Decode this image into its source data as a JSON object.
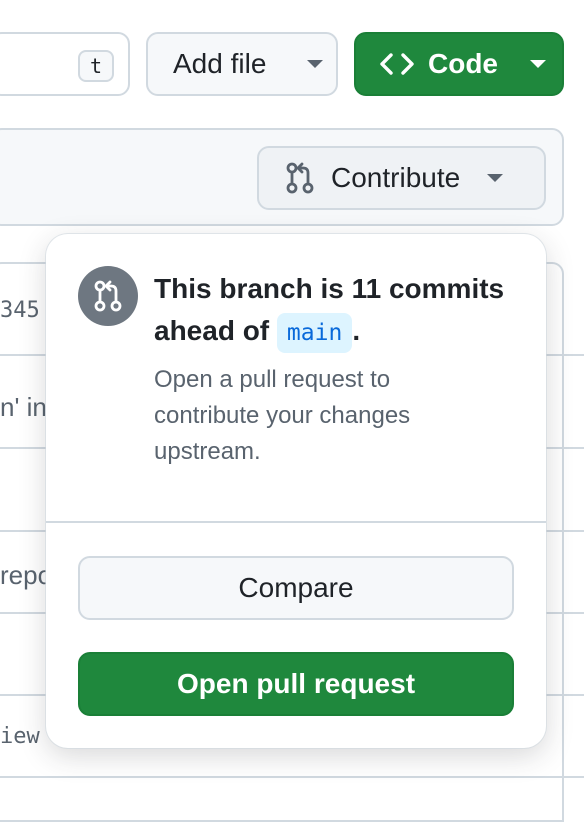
{
  "toolbar": {
    "search_shortcut": "t",
    "add_file_label": "Add file",
    "code_label": "Code"
  },
  "branch_bar": {
    "contribute_label": "Contribute"
  },
  "file_table": {
    "partial_rows": [
      "345",
      "n' in",
      "repo",
      "iew"
    ]
  },
  "popover": {
    "title_prefix": "This branch is 11 commits ahead of",
    "branch": "main",
    "title_suffix": ".",
    "description": "Open a pull request to contribute your changes upstream.",
    "compare_label": "Compare",
    "open_pr_label": "Open pull request"
  },
  "colors": {
    "primary_green": "#1f883d",
    "branch_pill_bg": "#ddf4ff",
    "branch_pill_text": "#0969da",
    "border": "#d1d9e0"
  }
}
